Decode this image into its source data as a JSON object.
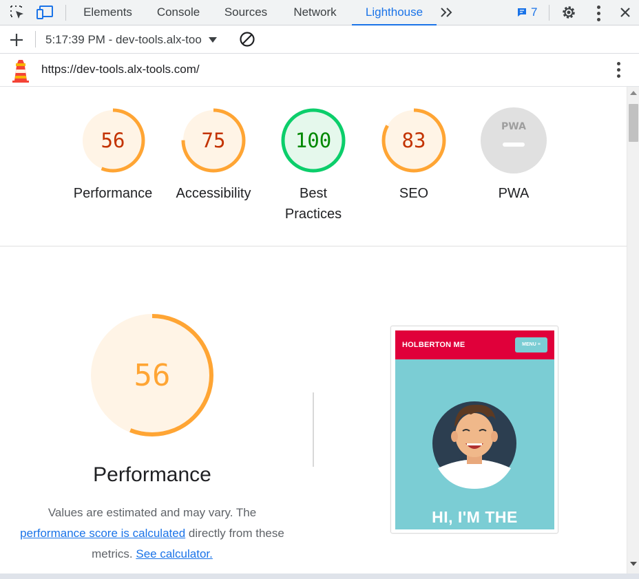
{
  "devtools": {
    "tabs": [
      {
        "label": "Elements"
      },
      {
        "label": "Console"
      },
      {
        "label": "Sources"
      },
      {
        "label": "Network"
      },
      {
        "label": "Lighthouse"
      }
    ],
    "active_tab": "Lighthouse",
    "issues_count": "7",
    "accent_color": "#1a73e8"
  },
  "toolbar": {
    "report_label": "5:17:39 PM - dev-tools.alx-too"
  },
  "urlbar": {
    "url": "https://dev-tools.alx-tools.com/"
  },
  "summary": {
    "gauges": [
      {
        "label": "Performance",
        "score": "56",
        "fraction": 0.56,
        "status": "average"
      },
      {
        "label": "Accessibility",
        "score": "75",
        "fraction": 0.75,
        "status": "average"
      },
      {
        "label": "Best Practices",
        "label_line1": "Best",
        "label_line2": "Practices",
        "score": "100",
        "fraction": 1.0,
        "status": "pass"
      },
      {
        "label": "SEO",
        "score": "83",
        "fraction": 0.83,
        "status": "average"
      },
      {
        "label": "PWA",
        "badge": "PWA"
      }
    ],
    "colors": {
      "average_arc": "#ffa534",
      "average_text": "#c33300",
      "average_bg": "#fff4e6",
      "pass_arc": "#0cce6b",
      "pass_text": "#008800",
      "pass_bg": "#e5f8ec",
      "pwa_bg": "#e0e0e0"
    }
  },
  "performance": {
    "score": "56",
    "fraction": 0.56,
    "title": "Performance",
    "description_part1": "Values are estimated and may vary. The",
    "link_score": "performance score is calculated",
    "description_part2": "directly from these metrics.",
    "link_calculator": "See calculator.",
    "score_text_color": "#ffa534"
  },
  "screenshot": {
    "brand": "HOLBERTON ME",
    "menu_label": "MENU ≡",
    "hero_text": "HI, I'M THE",
    "header_color": "#e0003a",
    "bg_color": "#7bcdd4"
  }
}
